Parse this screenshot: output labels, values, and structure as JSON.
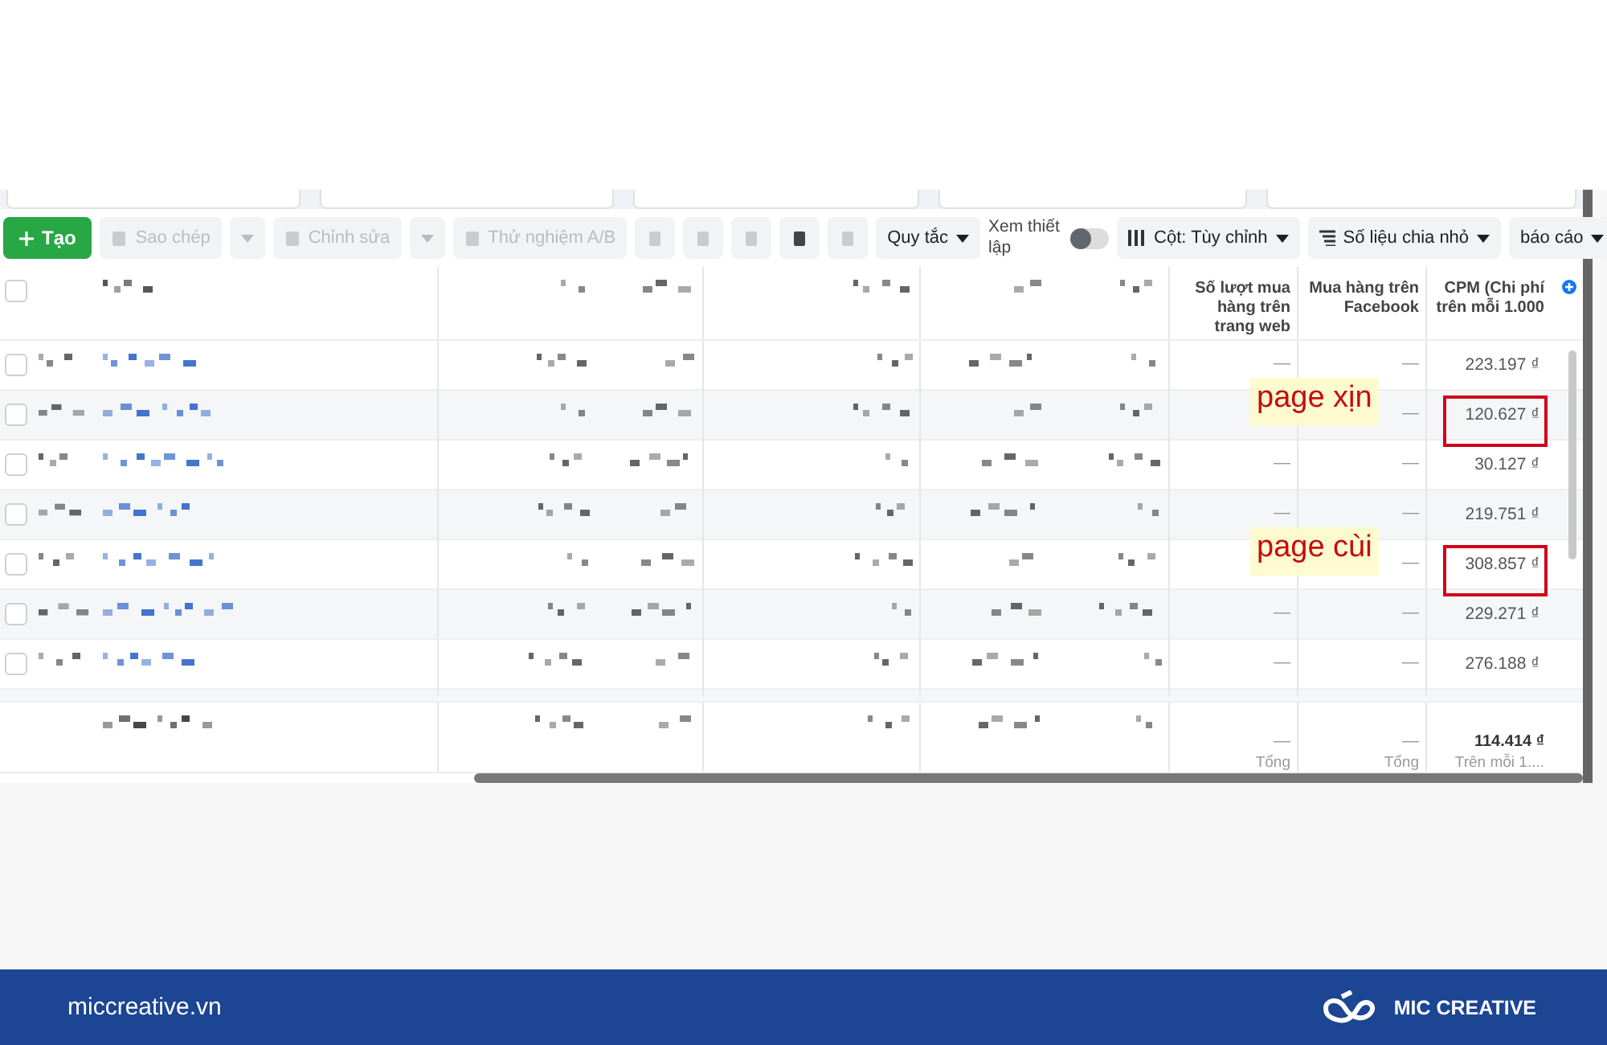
{
  "toolbar": {
    "create": "Tạo",
    "actions": [
      {
        "label": "Sao chép",
        "kind": "split",
        "disabled": true
      },
      {
        "label": "Chỉnh sửa",
        "kind": "split",
        "disabled": true
      },
      {
        "label": "Thử nghiệm A/B",
        "kind": "plain",
        "disabled": true
      }
    ],
    "rules": "Quy tắc",
    "view_setup": {
      "label": "Xem thiết lập",
      "on": false
    },
    "columns": "Cột: Tùy chỉnh",
    "breakdown": "Số liệu chia nhỏ",
    "reports": "báo cáo"
  },
  "table": {
    "all_checked": false,
    "columns": [
      "Số lượt mua hàng trên trang web",
      "Mua hàng trên Facebook",
      "CPM (Chi phí trên mỗi 1.000"
    ],
    "rows": [
      {
        "checked": false,
        "web": "—",
        "facebook": "—",
        "cpm": "223.197 ₫",
        "flagged": false
      },
      {
        "checked": false,
        "facebook": "—",
        "cpm": "120.627 ₫",
        "flagged": true,
        "annotation": "page xịn"
      },
      {
        "checked": false,
        "web": "—",
        "facebook": "—",
        "cpm": "30.127 ₫",
        "flagged": false
      },
      {
        "checked": false,
        "web": "—",
        "facebook": "—",
        "cpm": "219.751 ₫",
        "flagged": false
      },
      {
        "checked": false,
        "facebook": "—",
        "cpm": "308.857 ₫",
        "flagged": true,
        "annotation": "page cùi"
      },
      {
        "checked": false,
        "web": "—",
        "facebook": "—",
        "cpm": "229.271 ₫",
        "flagged": false
      },
      {
        "checked": false,
        "web": "—",
        "facebook": "—",
        "cpm": "276.188 ₫",
        "flagged": false
      }
    ],
    "total": {
      "web": "—",
      "web_note": "Tổng",
      "facebook": "—",
      "facebook_note": "Tổng",
      "cpm": "114.414 ₫",
      "cpm_note": "Trên mỗi 1...."
    }
  },
  "footer": {
    "site": "miccreative.vn",
    "brand": "MIC CREATIVE"
  }
}
